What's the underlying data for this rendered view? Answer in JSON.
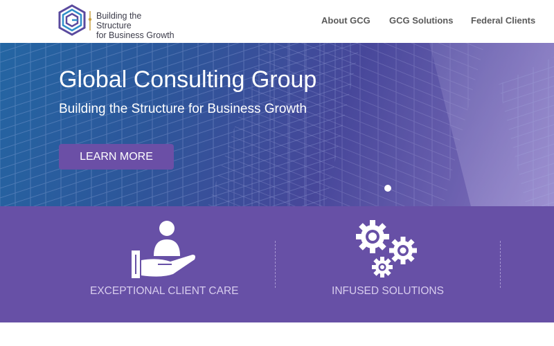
{
  "header": {
    "logo_icon": "gcg-hexagon-logo",
    "tagline": "Building the Structure\nfor Business Growth",
    "nav": [
      {
        "label": "About GCG"
      },
      {
        "label": "GCG Solutions"
      },
      {
        "label": "Federal Clients"
      }
    ]
  },
  "hero": {
    "title": "Global Consulting Group",
    "subtitle": "Building the Structure for Business Growth",
    "cta_label": "LEARN MORE",
    "background": "glass-skyscraper-photo",
    "slides_indicator": "active-dot"
  },
  "features": [
    {
      "icon": "hand-holding-person-icon",
      "label": "EXCEPTIONAL CLIENT CARE"
    },
    {
      "icon": "gears-icon",
      "label": "INFUSED SOLUTIONS"
    }
  ],
  "colors": {
    "brand_purple": "#6750a6",
    "button_purple": "#6b4fa6",
    "nav_text": "#5a5a5a",
    "feature_text": "#d8cdee"
  }
}
